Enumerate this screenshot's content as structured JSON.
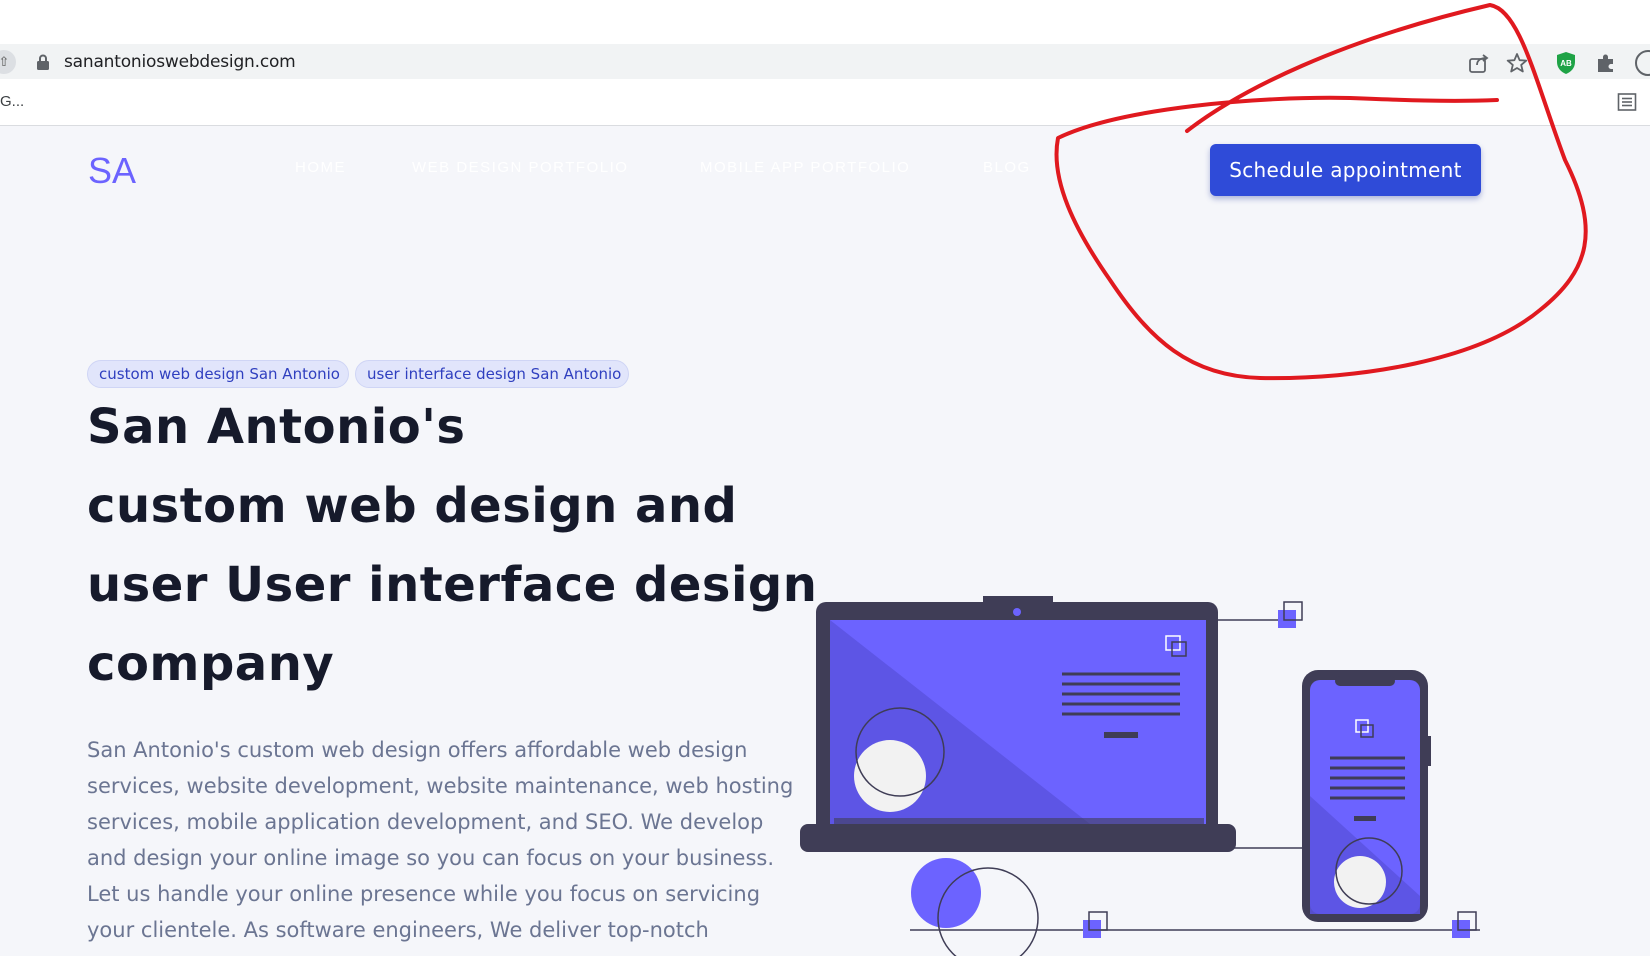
{
  "browser": {
    "url": "sanantonioswebdesign.com",
    "bookmark_label": "G..."
  },
  "header": {
    "logo": "SA",
    "nav": [
      {
        "label": "HOME"
      },
      {
        "label": "WEB DESIGN PORTFOLIO"
      },
      {
        "label": "MOBILE APP PORTFOLIO"
      },
      {
        "label": "BLOG"
      }
    ],
    "cta_label": "Schedule appointment"
  },
  "hero": {
    "tags": [
      "custom web design San Antonio",
      "user interface design San Antonio"
    ],
    "headline_lines": [
      "San Antonio's",
      "custom web design and",
      "user User interface design",
      "company"
    ],
    "description_lines": [
      "San Antonio's custom web design offers affordable web design",
      "services, website development, website maintenance, web hosting",
      "services, mobile application development, and SEO. We develop",
      "and design your online image so you can focus on your business.",
      "Let us handle your online presence while you focus on servicing",
      "your clientele. As software engineers, We deliver top-notch"
    ]
  },
  "colors": {
    "accent": "#6c63ff",
    "button": "#2f4bd8",
    "device_frame": "#3f3d56",
    "annotation": "#e0191f"
  }
}
